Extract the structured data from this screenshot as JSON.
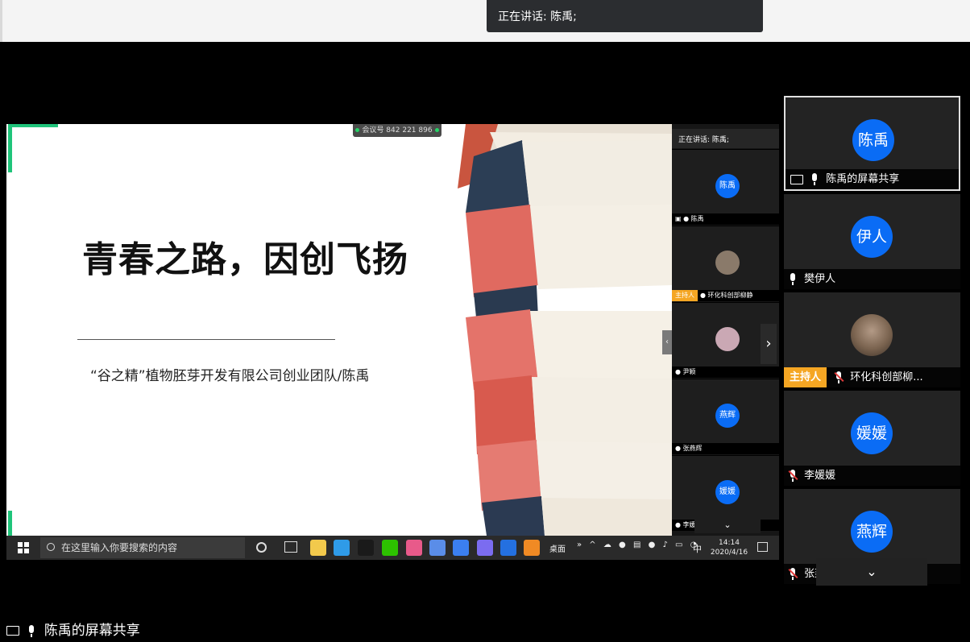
{
  "top_toast": {
    "text": "正在讲话: 陈禹;"
  },
  "slide": {
    "meeting_id": "会议号 842 221 896",
    "title": "青春之路，因创飞扬",
    "subtitle": "“谷之精”植物胚芽开发有限公司创业团队/陈禹"
  },
  "mini_panel": {
    "speaking": "正在讲话: 陈禹;",
    "tiles": [
      {
        "avatar": "陈禹",
        "label": "陈禹",
        "host": ""
      },
      {
        "avatar": "",
        "label": "环化科创部柳静",
        "host": "主持人"
      },
      {
        "avatar": "",
        "label": "尹颖",
        "host": ""
      },
      {
        "avatar": "燕辉",
        "label": "张燕辉",
        "host": ""
      },
      {
        "avatar": "媛媛",
        "label": "李媛媛",
        "host": ""
      }
    ],
    "next_arrow": "›",
    "prev_arrow": "‹",
    "down_arrow": "⌄"
  },
  "taskbar": {
    "search_placeholder": "在这里输入你要搜索的内容",
    "desktop": "桌面",
    "tray_more": "»",
    "ime": "中",
    "time": "14:14",
    "date": "2020/4/16",
    "apps": [
      {
        "name": "file-explorer-icon",
        "color": "#f2c94c"
      },
      {
        "name": "edge-icon",
        "color": "#2f9be8"
      },
      {
        "name": "qq-icon",
        "color": "#1a1a1a"
      },
      {
        "name": "wechat-icon",
        "color": "#2dc100"
      },
      {
        "name": "bilibili-icon",
        "color": "#e85a8a"
      },
      {
        "name": "tencent-meeting-icon",
        "color": "#5a8de8"
      },
      {
        "name": "wps-icon",
        "color": "#3b7ff0"
      },
      {
        "name": "app-purple-icon",
        "color": "#7b6cf0"
      },
      {
        "name": "app-blue-icon",
        "color": "#2470e0"
      },
      {
        "name": "player-icon",
        "color": "#f08a24"
      }
    ]
  },
  "sidebar": {
    "tiles": [
      {
        "avatar": "陈禹",
        "label": "陈禹的屏幕共享",
        "host": "",
        "mic": "on",
        "sharing": true
      },
      {
        "avatar": "伊人",
        "label": "樊伊人",
        "host": "",
        "mic": "on",
        "sharing": false
      },
      {
        "avatar": "",
        "label": "环化科创部柳...",
        "host": "主持人",
        "mic": "muted",
        "sharing": false
      },
      {
        "avatar": "媛媛",
        "label": "李媛媛",
        "host": "",
        "mic": "muted",
        "sharing": false
      },
      {
        "avatar": "燕辉",
        "label": "张燕辉",
        "host": "",
        "mic": "muted",
        "sharing": false
      }
    ],
    "down_arrow": "⌄"
  },
  "bottom_label": "陈禹的屏幕共享",
  "colors": {
    "accent_blue": "#0a6cf5",
    "host_orange": "#f5a623",
    "green_bar": "#1fc47a"
  }
}
